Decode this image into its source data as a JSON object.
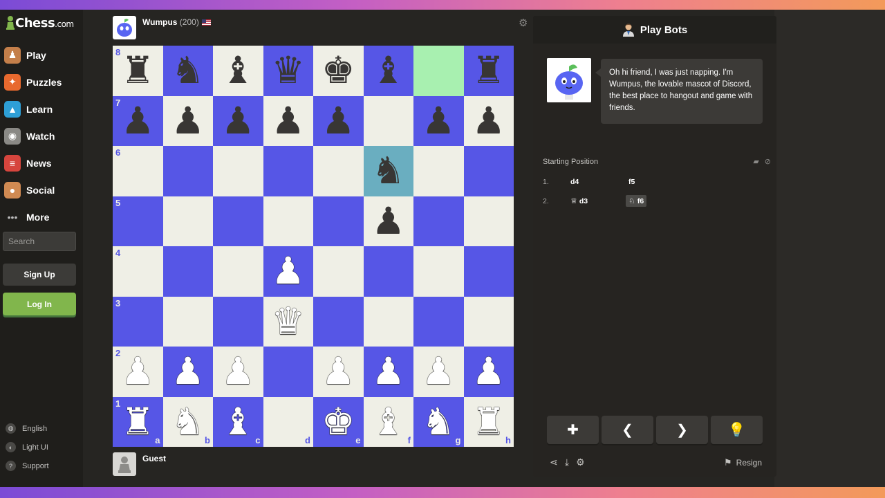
{
  "brand": {
    "logo_main": "Chess",
    "logo_domain": ".com"
  },
  "sidebar": {
    "items": [
      {
        "label": "Play",
        "icon": "play-icon"
      },
      {
        "label": "Puzzles",
        "icon": "puzzle-icon"
      },
      {
        "label": "Learn",
        "icon": "learn-icon"
      },
      {
        "label": "Watch",
        "icon": "binoculars-icon"
      },
      {
        "label": "News",
        "icon": "news-icon"
      },
      {
        "label": "Social",
        "icon": "social-icon"
      },
      {
        "label": "More",
        "icon": "more-icon"
      }
    ],
    "search_placeholder": "Search",
    "signup_label": "Sign Up",
    "login_label": "Log In",
    "footer": [
      {
        "label": "English",
        "icon": "globe-icon"
      },
      {
        "label": "Light UI",
        "icon": "contrast-icon"
      },
      {
        "label": "Support",
        "icon": "help-icon"
      }
    ]
  },
  "players": {
    "top": {
      "name": "Wumpus",
      "rating": "(200)"
    },
    "bottom": {
      "name": "Guest"
    }
  },
  "board": {
    "ranks": [
      "8",
      "7",
      "6",
      "5",
      "4",
      "3",
      "2",
      "1"
    ],
    "files": [
      "a",
      "b",
      "c",
      "d",
      "e",
      "f",
      "g",
      "h"
    ],
    "position": [
      [
        "bR",
        "bN",
        "bB",
        "bQ",
        "bK",
        "bB",
        "",
        "bR"
      ],
      [
        "bP",
        "bP",
        "bP",
        "bP",
        "bP",
        "",
        "bP",
        "bP"
      ],
      [
        "",
        "",
        "",
        "",
        "",
        "bN",
        "",
        ""
      ],
      [
        "",
        "",
        "",
        "",
        "",
        "bP",
        "",
        ""
      ],
      [
        "",
        "",
        "",
        "wP",
        "",
        "",
        "",
        ""
      ],
      [
        "",
        "",
        "",
        "wQ",
        "",
        "",
        "",
        ""
      ],
      [
        "wP",
        "wP",
        "wP",
        "",
        "wP",
        "wP",
        "wP",
        "wP"
      ],
      [
        "wR",
        "wN",
        "wB",
        "",
        "wK",
        "wB",
        "wN",
        "wR"
      ]
    ],
    "highlights": [
      "g8",
      "f6"
    ],
    "colors": {
      "light": "#efefe6",
      "dark": "#5656e6"
    }
  },
  "panel": {
    "title": "Play Bots",
    "bot_message": "Oh hi friend, I was just napping. I'm Wumpus, the lovable mascot of Discord, the best place to hangout and game with friends.",
    "moves_title": "Starting Position",
    "moves": [
      {
        "num": "1.",
        "white": "d4",
        "black": "f5"
      },
      {
        "num": "2.",
        "white": "d3",
        "black": "f6"
      }
    ],
    "resign_label": "Resign"
  }
}
